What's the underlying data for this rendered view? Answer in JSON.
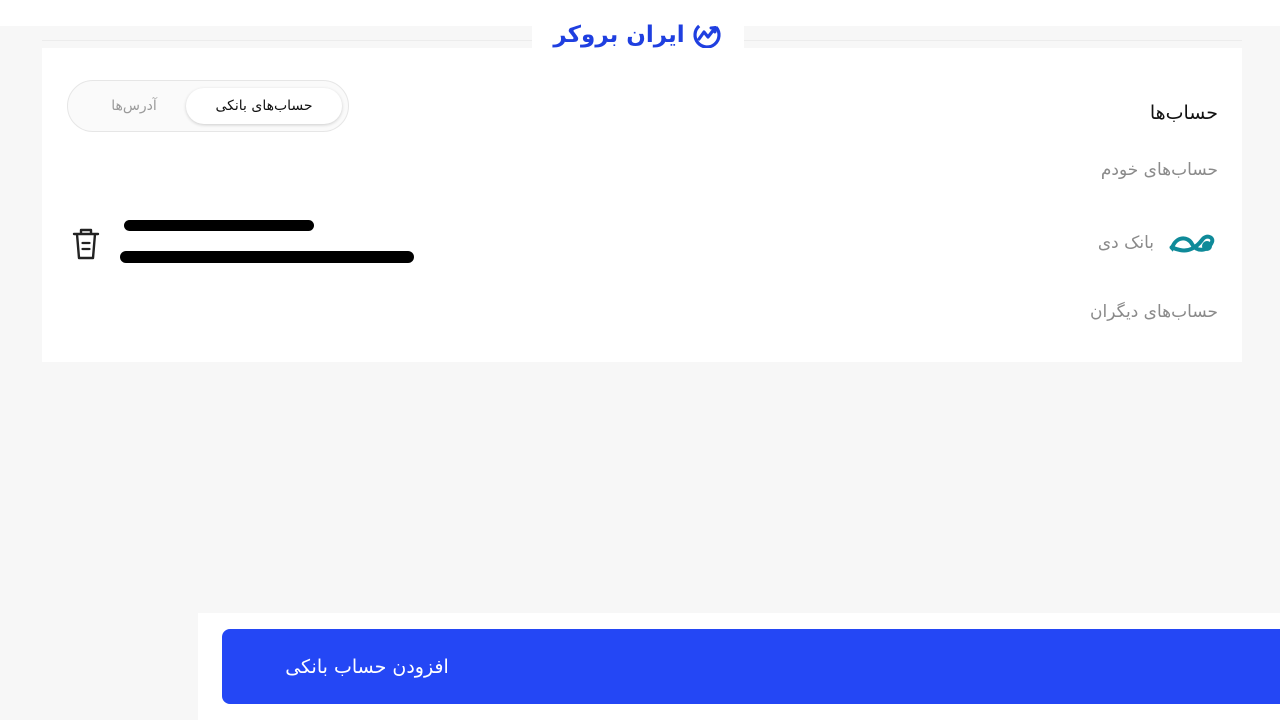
{
  "header": {
    "logo_text": "ایران بروکر",
    "logo_icon": "chart-up-icon",
    "brand_color": "#1f3fe0"
  },
  "accounts": {
    "title": "حساب‌ها",
    "tabs": [
      {
        "label": "حساب‌های بانکی",
        "active": true
      },
      {
        "label": "آدرس‌ها",
        "active": false
      }
    ],
    "own_section_label": "حساب‌های خودم",
    "others_section_label": "حساب‌های دیگران",
    "bank": {
      "name": "بانک دی",
      "logo_icon": "bank-dey-logo",
      "logo_color": "#0f8a99"
    },
    "delete_icon": "trash-icon"
  },
  "footer": {
    "add_button_label": "افزودن حساب بانکی",
    "button_color": "#2447f5"
  }
}
